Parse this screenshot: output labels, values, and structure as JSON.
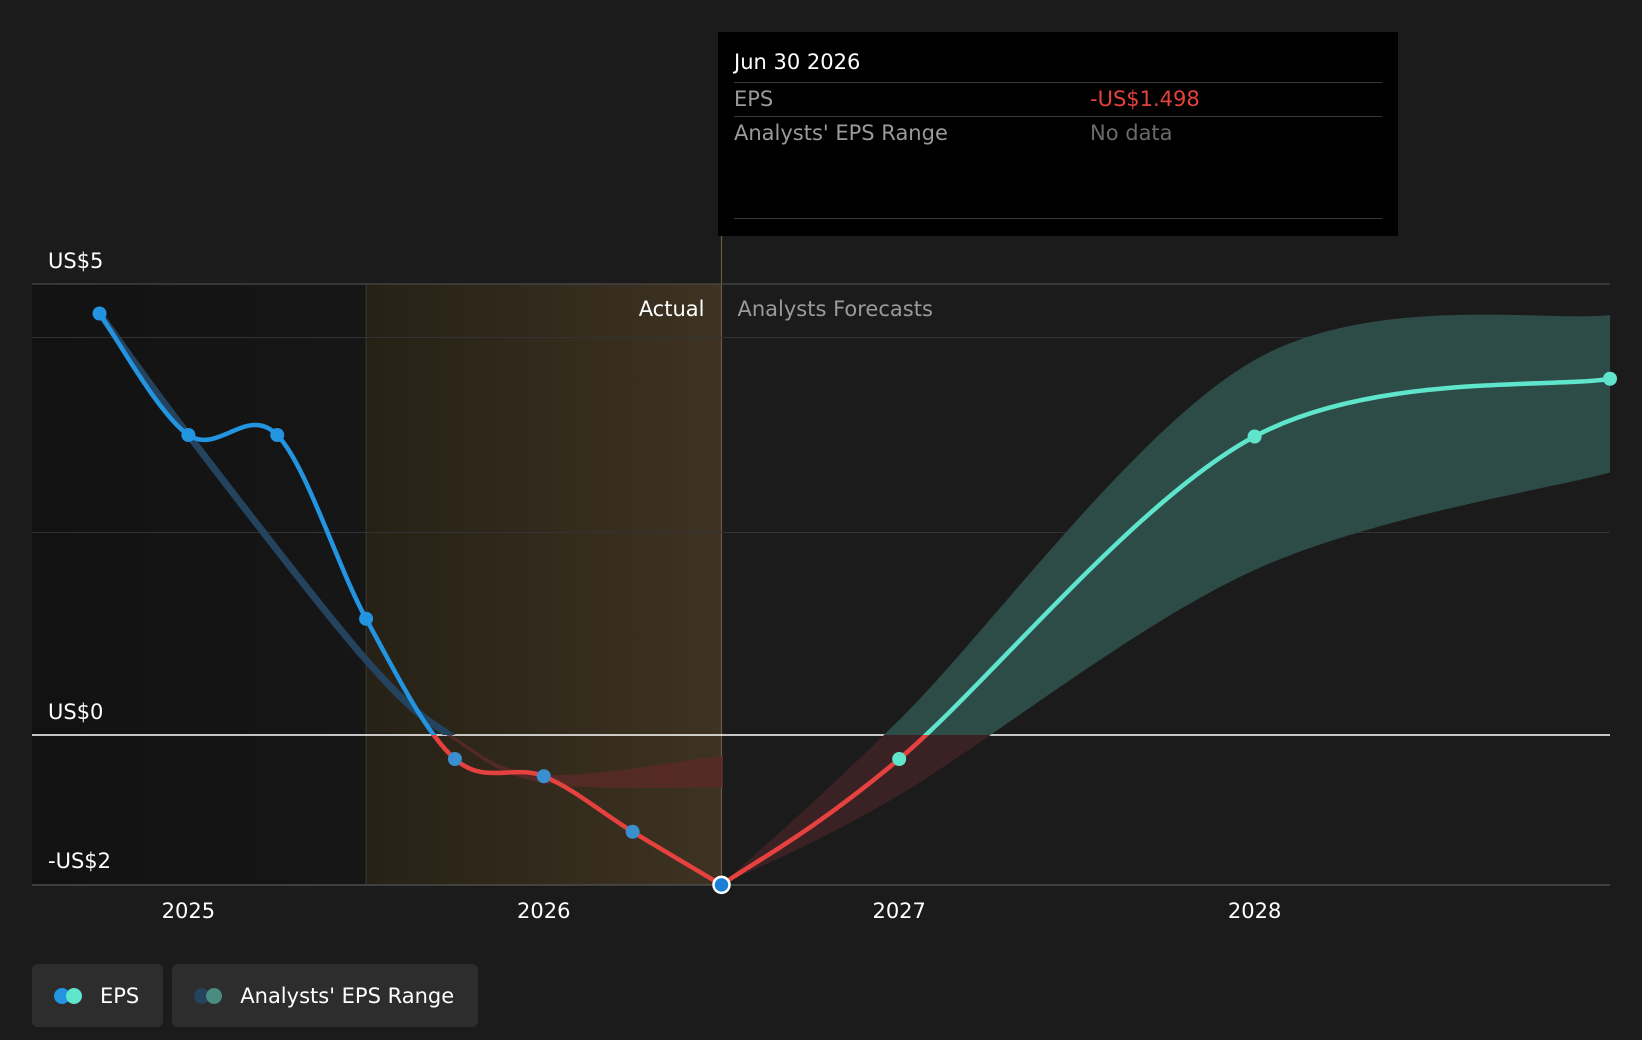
{
  "chart_data": {
    "type": "line",
    "y_tick_labels": [
      {
        "value": 5,
        "label": "US$5"
      },
      {
        "value": 0,
        "label": "US$0"
      },
      {
        "value": -2,
        "label": "-US$2"
      }
    ],
    "x_ticks": [
      {
        "value": 2025,
        "label": "2025"
      },
      {
        "value": 2026,
        "label": "2026"
      },
      {
        "value": 2027,
        "label": "2027"
      },
      {
        "value": 2028,
        "label": "2028"
      }
    ],
    "xlim": [
      2024.56,
      2029.0
    ],
    "ylim": [
      -2.0,
      6.0
    ],
    "grid_y": [
      2.7,
      5.3
    ],
    "section_labels": {
      "actual": "Actual",
      "forecast": "Analysts Forecasts"
    },
    "eps_actual": [
      {
        "x": 2024.75,
        "y": 5.62
      },
      {
        "x": 2025.0,
        "y": 4.0
      },
      {
        "x": 2025.25,
        "y": 4.0
      },
      {
        "x": 2025.5,
        "y": 1.55
      },
      {
        "x": 2025.75,
        "y": -0.32
      },
      {
        "x": 2026.0,
        "y": -0.55
      },
      {
        "x": 2026.25,
        "y": -1.29
      },
      {
        "x": 2026.5,
        "y": -1.998
      }
    ],
    "eps_forecast": [
      {
        "x": 2026.5,
        "y": -1.998
      },
      {
        "x": 2027.0,
        "y": -0.32
      },
      {
        "x": 2028.0,
        "y": 3.98
      },
      {
        "x": 2029.0,
        "y": 4.75
      }
    ],
    "analyst_range_past": [
      {
        "x": 2024.75,
        "low": 5.62,
        "high": 5.62
      },
      {
        "x": 2025.0,
        "low": 4.0,
        "high": 4.0
      },
      {
        "x": 2025.5,
        "low": 1.0,
        "high": 1.0
      },
      {
        "x": 2025.75,
        "low": -0.05,
        "high": -0.05
      },
      {
        "x": 2026.0,
        "low": -0.62,
        "high": -0.55
      },
      {
        "x": 2026.5,
        "low": -0.68,
        "high": -0.3
      }
    ],
    "analyst_range_forecast": [
      {
        "x": 2026.5,
        "low": -1.998,
        "high": -1.998
      },
      {
        "x": 2027.0,
        "low": -0.8,
        "high": 0.2
      },
      {
        "x": 2028.0,
        "low": 2.2,
        "high": 5.0
      },
      {
        "x": 2029.0,
        "low": 3.5,
        "high": 5.6
      }
    ],
    "highlight": {
      "x_start": 2025.5,
      "x_end": 2026.5
    },
    "selected_x": 2026.5,
    "colors": {
      "eps_actual_positive": "#2394e0",
      "eps_negative": "#e5413f",
      "eps_forecast": "#5fe5cc",
      "range_past": "#23435e",
      "range_forecast": "#2d4b47",
      "range_negative": "#5a2a28",
      "highlight": "#3a3020",
      "tooltip_negative": "#e5413f"
    }
  },
  "tooltip": {
    "date": "Jun 30 2026",
    "rows": [
      {
        "label": "EPS",
        "value": "-US$1.498"
      },
      {
        "label": "Analysts' EPS Range",
        "value": "No data"
      }
    ]
  },
  "legend": [
    {
      "label": "EPS",
      "dot_colors": [
        "#2394e0",
        "#5fe5cc"
      ]
    },
    {
      "label": "Analysts' EPS Range",
      "dot_colors": [
        "#23435e",
        "#4a8c82"
      ]
    }
  ]
}
